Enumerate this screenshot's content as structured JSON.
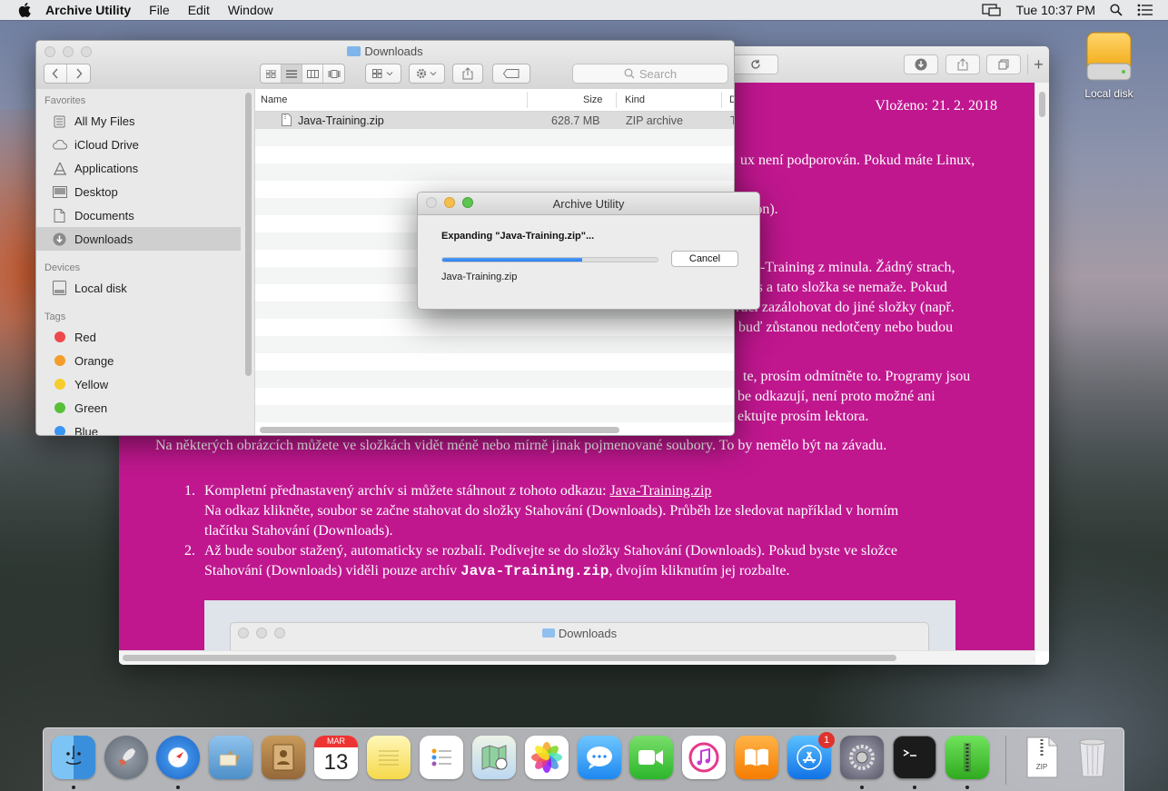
{
  "menubar": {
    "app_name": "Archive Utility",
    "menus": [
      "File",
      "Edit",
      "Window"
    ],
    "time": "Tue 10:37 PM"
  },
  "desktop": {
    "disk_label": "Local disk"
  },
  "browser": {
    "date_line": "Vloženo: 21. 2. 2018",
    "frag1": "ux není podporován. Pokud máte Linux,",
    "frag2": "dition).",
    "frag3": "-Training z minula. Žádný strach,",
    "frag4": "ects a tato složka se nemaže. Pokud",
    "frag5": "ručí zazálohovat do jiné složky (např.",
    "frag6": "buď zůstanou nedotčeny nebo budou",
    "frag7": "te, prosím odmítněte to. Programy jsou",
    "frag8": "be odkazují, není proto možné ani",
    "frag9": "ektujte prosím lektora.",
    "para_images": "Na některých obrázcích můžete ve složkách vidět méně nebo mírně jinak pojmenované soubory. To by nemělo být na závadu.",
    "step1_num": "1.",
    "step1_a": "Kompletní přednastavený archív si můžete stáhnout z tohoto odkazu: ",
    "step1_link": "Java-Training.zip",
    "step1_b": "Na odkaz klikněte, soubor se začne stahovat do složky Stahování (Downloads). Průběh lze sledovat například v horním",
    "step1_c": "tlačítku Stahování (Downloads).",
    "step2_num": "2.",
    "step2_a": "Až bude soubor stažený, automaticky se rozbalí. Podívejte se do složky Stahování (Downloads). Pokud byste ve složce",
    "step2_b": "Stahování (Downloads) viděli pouze archív ",
    "step2_code": "Java-Training.zip",
    "step2_c": ", dvojím kliknutím jej rozbalte.",
    "shot_title": "Downloads"
  },
  "finder": {
    "title": "Downloads",
    "search_placeholder": "Search",
    "favorites_header": "Favorites",
    "favorites": [
      "All My Files",
      "iCloud Drive",
      "Applications",
      "Desktop",
      "Documents",
      "Downloads"
    ],
    "devices_header": "Devices",
    "devices": [
      "Local disk"
    ],
    "tags_header": "Tags",
    "tags": [
      {
        "label": "Red",
        "color": "#f0484b"
      },
      {
        "label": "Orange",
        "color": "#f49d2b"
      },
      {
        "label": "Yellow",
        "color": "#f6cd2c"
      },
      {
        "label": "Green",
        "color": "#57c038"
      },
      {
        "label": "Blue",
        "color": "#3b95f4"
      }
    ],
    "columns": {
      "name": "Name",
      "size": "Size",
      "kind": "Kind",
      "date": "D"
    },
    "files": [
      {
        "name": "Java-Training.zip",
        "size": "628.7 MB",
        "kind": "ZIP archive",
        "date": "T"
      }
    ]
  },
  "dialog": {
    "title": "Archive Utility",
    "message": "Expanding \"Java-Training.zip\"...",
    "file": "Java-Training.zip",
    "cancel": "Cancel",
    "progress": 0.65
  },
  "dock": {
    "calendar_month": "MAR",
    "calendar_day": "13",
    "appstore_badge": "1",
    "zip_label": "ZIP"
  }
}
